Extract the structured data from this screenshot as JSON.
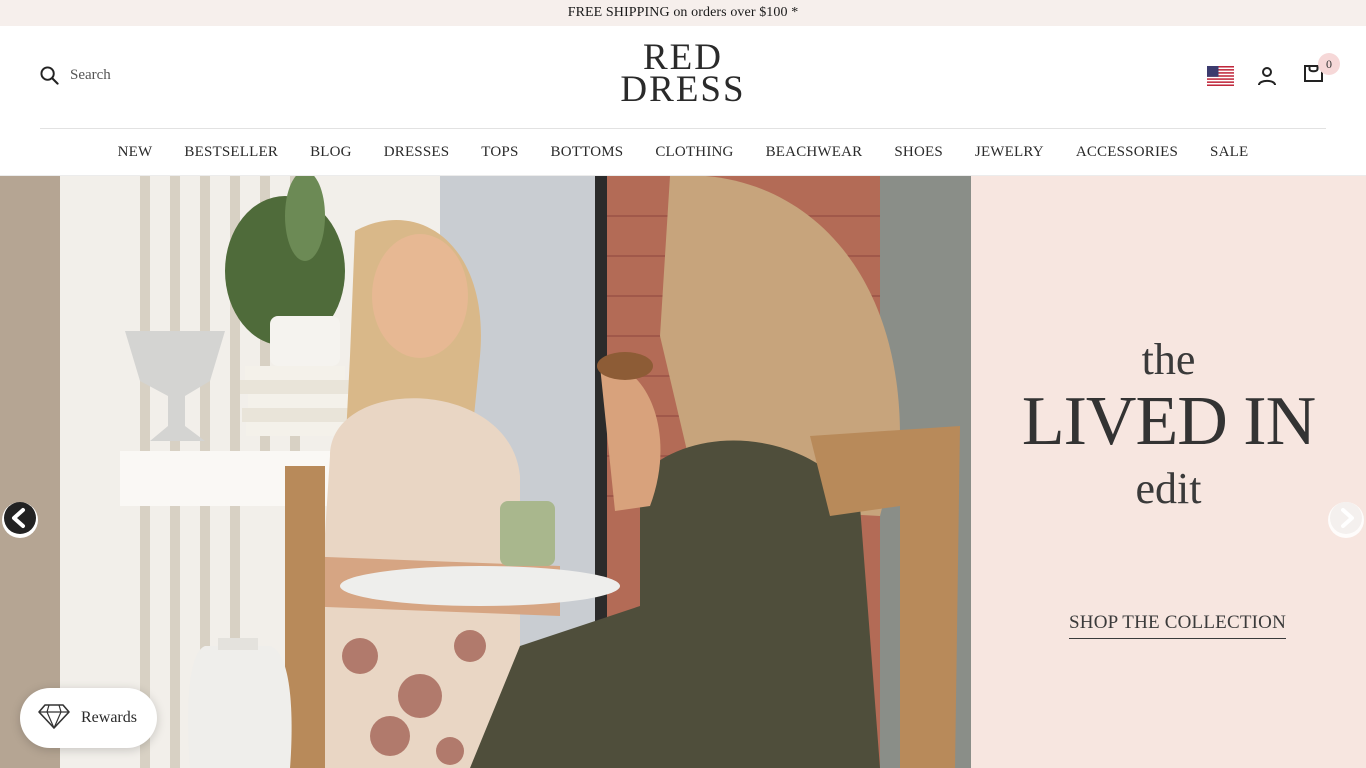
{
  "announcement": {
    "text": "FREE SHIPPING on orders over $100 *"
  },
  "header": {
    "search_label": "Search",
    "logo_line1": "RED",
    "logo_line2": "DRESS",
    "cart_count": "0"
  },
  "nav": {
    "items": [
      "NEW",
      "BESTSELLER",
      "BLOG",
      "DRESSES",
      "TOPS",
      "BOTTOMS",
      "CLOTHING",
      "BEACHWEAR",
      "SHOES",
      "JEWELRY",
      "ACCESSORIES",
      "SALE"
    ]
  },
  "hero": {
    "promo_the": "the",
    "promo_main": "LIVED IN",
    "promo_edit": "edit",
    "cta": "SHOP THE COLLECTION",
    "panel_color": "#f7e6e0"
  },
  "rewards": {
    "label": "Rewards"
  },
  "icons": {
    "search": "search-icon",
    "flag": "us-flag-icon",
    "account": "account-icon",
    "cart": "cart-icon",
    "prev": "chevron-left-icon",
    "next": "chevron-right-icon",
    "rewards": "diamond-icon"
  }
}
